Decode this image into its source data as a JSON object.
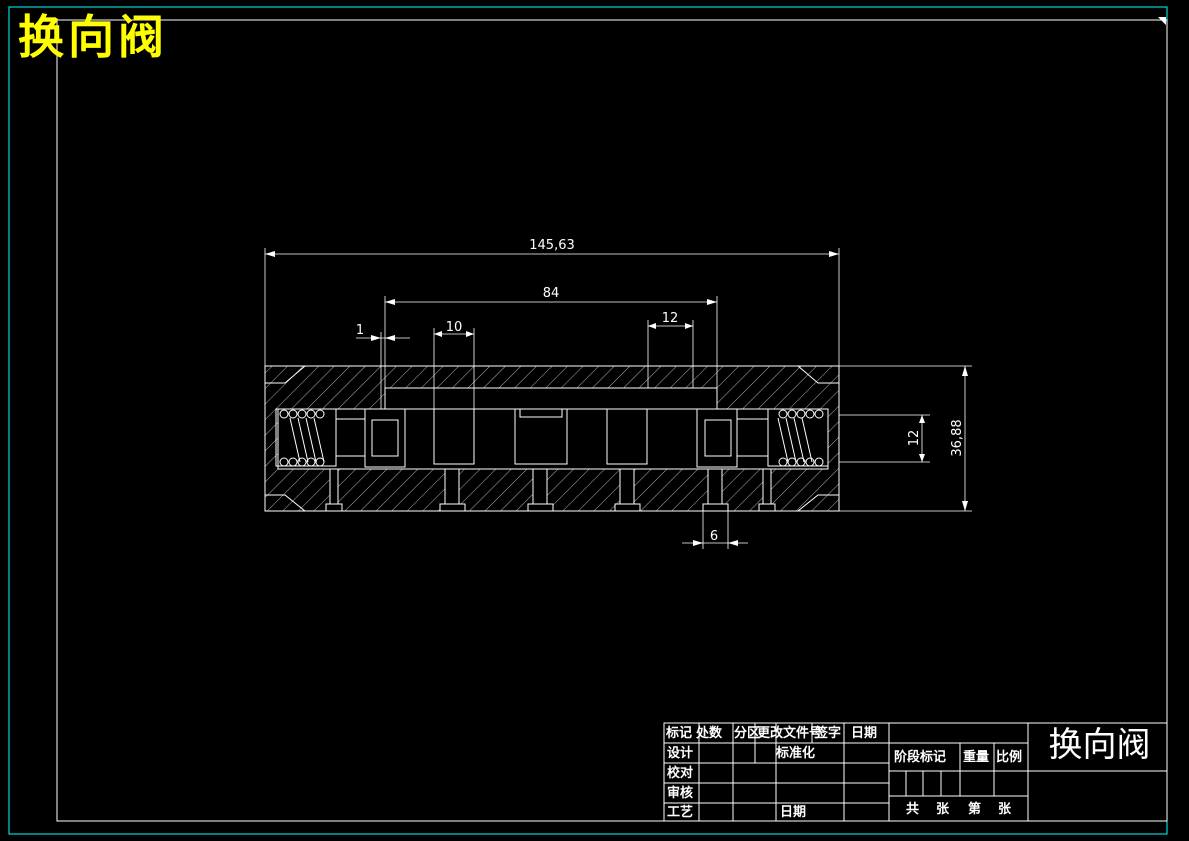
{
  "drawing_title": "换向阀",
  "dimensions": {
    "overall_length": "145,63",
    "spool_length": "84",
    "gap": "1",
    "land_width": "10",
    "port_width": "12",
    "bore_diameter": "12",
    "overall_height": "36,88",
    "port_spacing": "6"
  },
  "title_block": {
    "header": {
      "mark": "标记",
      "count": "处数",
      "zone": "分区",
      "change_doc": "更改文件号",
      "signature": "签字",
      "date": "日期"
    },
    "design": "设计",
    "standardization": "标准化",
    "check": "校对",
    "review": "审核",
    "process": "工艺",
    "date2": "日期",
    "stage_mark": "阶段标记",
    "weight": "重量",
    "scale": "比例",
    "total": "共",
    "sheets": "张",
    "sheet_no": "第",
    "sheets2": "张",
    "part_name": "换向阀"
  },
  "colors": {
    "background": "#000000",
    "lines": "#ffffff",
    "border": "#00ffff",
    "title": "#ffff00"
  }
}
